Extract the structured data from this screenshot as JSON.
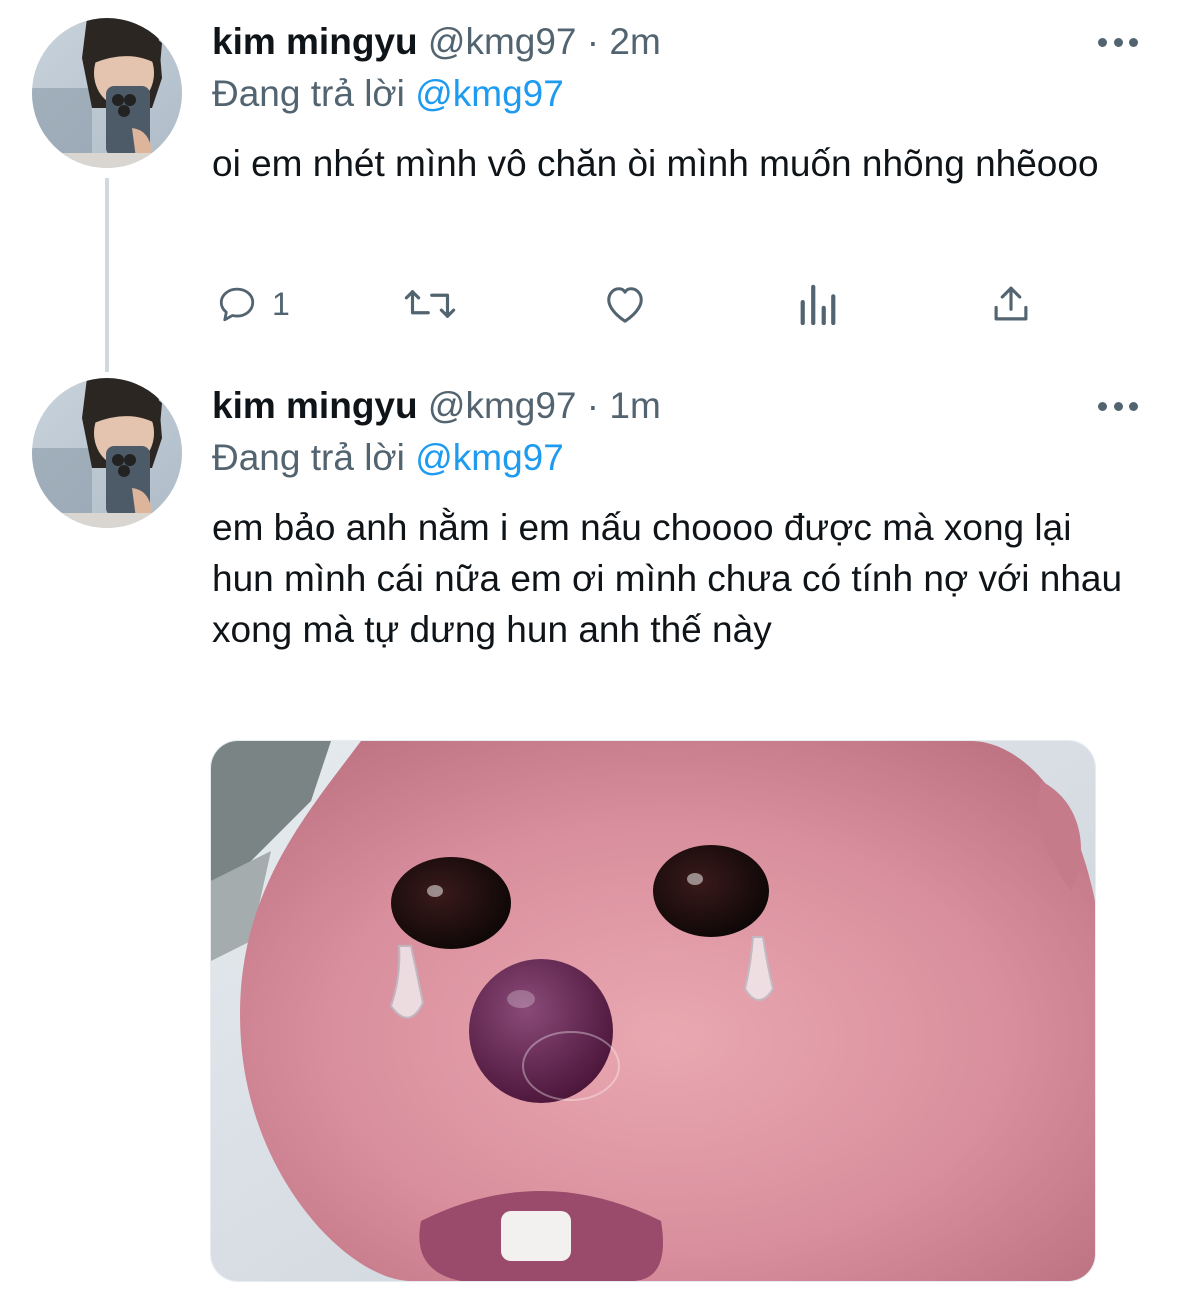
{
  "tweets": [
    {
      "name": "kim mingyu",
      "handle": "@kmg97",
      "dot": "·",
      "time": "2m",
      "reply_prefix": "Đang trả lời",
      "reply_to": "@kmg97",
      "text": "oi em nhét mình vô chăn òi mình muốn nhõng nhẽooo",
      "actions": {
        "reply_count": "1",
        "reply_icon": "reply-icon",
        "retweet_icon": "retweet-icon",
        "like_icon": "heart-icon",
        "stats_icon": "analytics-icon",
        "share_icon": "share-icon"
      }
    },
    {
      "name": "kim mingyu",
      "handle": "@kmg97",
      "dot": "·",
      "time": "1m",
      "reply_prefix": "Đang trả lời",
      "reply_to": "@kmg97",
      "text": "em bảo anh nằm i em nấu choooo được mà xong lại hun mình cái nữa em ơi mình chưa có tính nợ với nhau xong mà tự dưng hun anh thế này",
      "media": "crying-pink-beaver-image"
    }
  ],
  "colors": {
    "text_primary": "#0f1419",
    "text_secondary": "#536471",
    "link": "#1d9bf0",
    "thread_line": "#cfd9de"
  }
}
